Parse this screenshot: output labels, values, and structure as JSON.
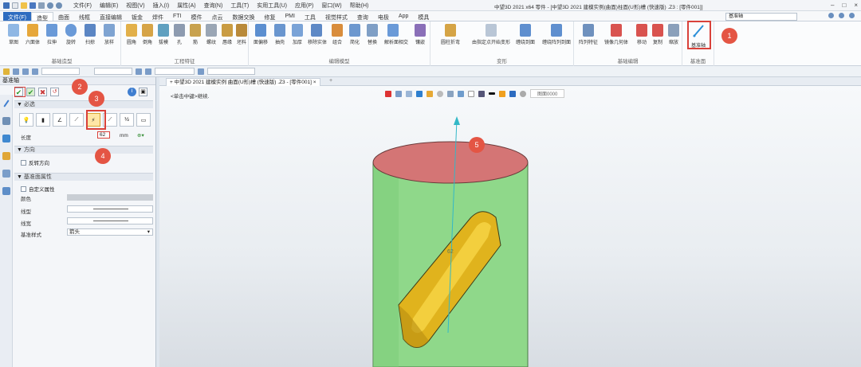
{
  "title_bar": {
    "menus": [
      "文件(F)",
      "编辑(E)",
      "视图(V)",
      "插入(I)",
      "属性(A)",
      "查询(N)",
      "工具(T)",
      "实用工具(U)",
      "应用(P)",
      "窗口(W)",
      "帮助(H)"
    ],
    "window_title": "中望3D 2021 x64      零件 - [中望3D 2021 建模实例(曲面)柱面(U形)槽 (快速版) .Z3 : [零件001]]"
  },
  "ribbon_tabs": {
    "file": "文件(F)",
    "tabs": [
      "造型",
      "曲面",
      "线框",
      "直接编辑",
      "钣金",
      "焊件",
      "FTI",
      "模件",
      "点云",
      "数据交换",
      "修复",
      "PMI",
      "工具",
      "视觉样式",
      "查询",
      "电极",
      "App",
      "模具"
    ],
    "active": "造型",
    "search_value": "基准轴"
  },
  "ribbon_groups": [
    {
      "name": "基础造型",
      "buttons": [
        "草图",
        "六面体",
        "拉伸",
        "旋转",
        "扫掠",
        "放样"
      ]
    },
    {
      "name": "工程特征",
      "buttons": [
        "圆角",
        "倒角",
        "拔模",
        "孔",
        "筋",
        "螺纹",
        "唇缘",
        "坯料"
      ]
    },
    {
      "name": "编辑模型",
      "buttons": [
        "面偏移",
        "抽壳",
        "加厚",
        "移除实体",
        "组合",
        "简化",
        "替换",
        "解析面相交",
        "镶嵌"
      ]
    },
    {
      "name": "变形",
      "buttons": [
        "圆柱折弯",
        "由指定点开始变形",
        "缠绕到面",
        "缠绕阵列到面"
      ]
    },
    {
      "name": "基础编辑",
      "buttons": [
        "阵列特征",
        "镜像几何体",
        "移动",
        "复制",
        "缩放"
      ]
    },
    {
      "name": "基准面",
      "buttons": [
        "基准轴"
      ]
    }
  ],
  "panel": {
    "title": "基准轴",
    "section_required": "必选",
    "length_label": "长度",
    "length_value": "62",
    "length_unit": "mm",
    "section_direction": "方向",
    "reverse_direction": "反转方向",
    "section_props": "基准面属性",
    "custom_props": "自定义属性",
    "color_label": "颜色",
    "linetype_label": "线型",
    "linewidth_label": "线宽",
    "datum_style_label": "基准样式",
    "datum_style_value": "箭头"
  },
  "doc_tab": "中望3D 2021 建模实例 曲面(U形)槽 (快速版) .Z3 - [零件001]",
  "viewport": {
    "hint": "<单击中键>继续.",
    "view_label": "图面0000",
    "dim_label": "62"
  },
  "annotations": [
    "1",
    "2",
    "3",
    "4",
    "5"
  ],
  "colors": {
    "cylinder": "#8fd88a",
    "top_face": "#d47575",
    "slot": "#e0b31d",
    "axis": "#33b8c7",
    "badge": "#e45544",
    "highlight": "#d9413a",
    "file_tab": "#2d6cc0"
  }
}
